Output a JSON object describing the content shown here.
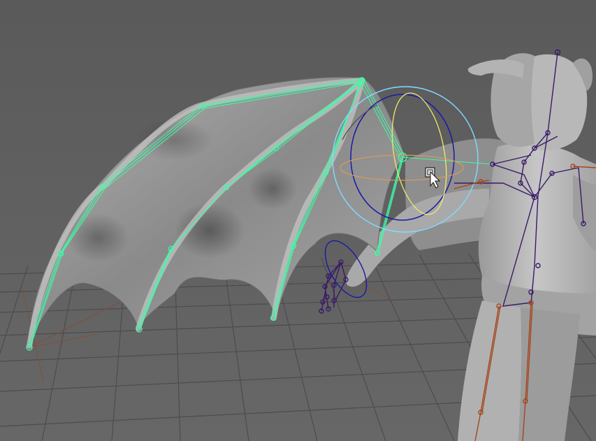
{
  "viewport": {
    "background": "#5f5f5f",
    "grid_color": "#4a4a4a",
    "grid_highlight": "#525252"
  },
  "colors": {
    "wing_skin": "#9c9c9c",
    "wing_skin_dark": "#3a3a3a",
    "wing_joints": "#3dfca6",
    "body_mesh": "#b6b6b6",
    "spine_joints": "#3a1a66",
    "leg_joints": "#a3461d",
    "rotate_outer": "#7fdcff",
    "rotate_x": "#1a1aa6",
    "rotate_y": "#ecec6c",
    "rotate_z": "#d89a5a"
  },
  "icons": {
    "cursor": "arrow-pointer-icon",
    "manipulator": "rotate-manipulator-icon"
  }
}
